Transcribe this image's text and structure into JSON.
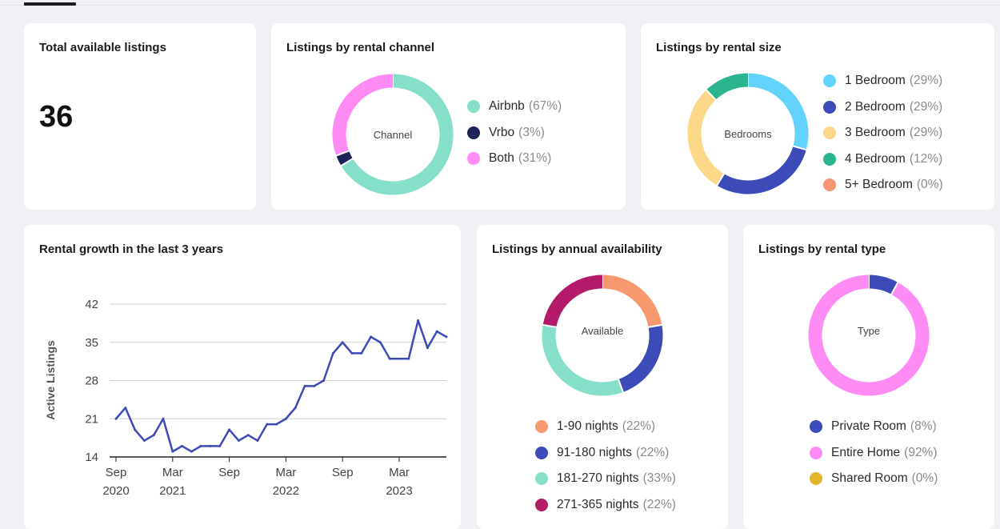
{
  "total": {
    "title": "Total available listings",
    "value": "36"
  },
  "channel": {
    "title": "Listings by rental channel",
    "center": "Channel",
    "legend": [
      {
        "label": "Airbnb",
        "pct": "(67%)",
        "value": 67,
        "color": "#86dfc9"
      },
      {
        "label": "Vrbo",
        "pct": "(3%)",
        "value": 3,
        "color": "#1d2357"
      },
      {
        "label": "Both",
        "pct": "(31%)",
        "value": 31,
        "color": "#ff8cf5"
      }
    ]
  },
  "size": {
    "title": "Listings by rental size",
    "center": "Bedrooms",
    "legend": [
      {
        "label": "1 Bedroom",
        "pct": "(29%)",
        "value": 29,
        "color": "#63d3fb"
      },
      {
        "label": "2 Bedroom",
        "pct": "(29%)",
        "value": 29,
        "color": "#3c4bb8"
      },
      {
        "label": "3 Bedroom",
        "pct": "(29%)",
        "value": 29,
        "color": "#fdd888"
      },
      {
        "label": "4 Bedroom",
        "pct": "(12%)",
        "value": 12,
        "color": "#2bb58f"
      },
      {
        "label": "5+ Bedroom",
        "pct": "(0%)",
        "value": 0,
        "color": "#f79575"
      }
    ]
  },
  "growth": {
    "title": "Rental growth in the last 3 years",
    "chart_data": {
      "type": "line",
      "ylabel": "Active Listings",
      "xlabel": "",
      "ylim": [
        14,
        42
      ],
      "yticks": [
        14,
        21,
        28,
        35,
        42
      ],
      "xticks": [
        {
          "line1": "Sep",
          "line2": "2020",
          "index": 0
        },
        {
          "line1": "Mar",
          "line2": "2021",
          "index": 6
        },
        {
          "line1": "Sep",
          "line2": "",
          "index": 12
        },
        {
          "line1": "Mar",
          "line2": "2022",
          "index": 18
        },
        {
          "line1": "Sep",
          "line2": "",
          "index": 24
        },
        {
          "line1": "Mar",
          "line2": "2023",
          "index": 30
        }
      ],
      "color": "#3c4bb8",
      "series": [
        {
          "values": [
            21,
            23,
            19,
            17,
            18,
            21,
            15,
            16,
            15,
            16,
            16,
            16,
            19,
            17,
            18,
            17,
            20,
            20,
            21,
            23,
            27,
            27,
            28,
            33,
            35,
            33,
            33,
            36,
            35,
            32,
            32,
            32,
            39,
            34,
            37,
            36
          ]
        }
      ]
    }
  },
  "availability": {
    "title": "Listings by annual availability",
    "center": "Available",
    "legend": [
      {
        "label": "1-90 nights",
        "pct": "(22%)",
        "value": 22,
        "color": "#f7986f"
      },
      {
        "label": "91-180 nights",
        "pct": "(22%)",
        "value": 22,
        "color": "#3c4bb8"
      },
      {
        "label": "181-270 nights",
        "pct": "(33%)",
        "value": 33,
        "color": "#86dfc9"
      },
      {
        "label": "271-365 nights",
        "pct": "(22%)",
        "value": 22,
        "color": "#b41a6a"
      }
    ]
  },
  "type": {
    "title": "Listings by rental type",
    "center": "Type",
    "legend": [
      {
        "label": "Private Room",
        "pct": "(8%)",
        "value": 8,
        "color": "#3c4bb8"
      },
      {
        "label": "Entire Home",
        "pct": "(92%)",
        "value": 92,
        "color": "#ff8cf5"
      },
      {
        "label": "Shared Room",
        "pct": "(0%)",
        "value": 0,
        "color": "#e2b62c"
      }
    ]
  }
}
